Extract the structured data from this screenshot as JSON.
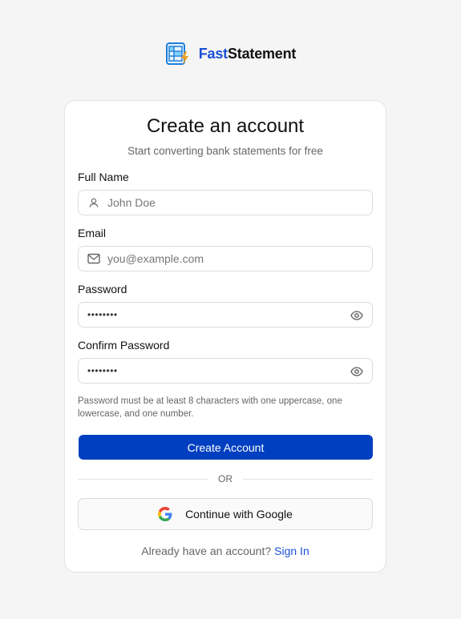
{
  "brand": {
    "name_part1": "Fast",
    "name_part2": "Statement",
    "logo_icon": "spreadsheet-lightning-icon",
    "accent": "#1a4fd6"
  },
  "card": {
    "title": "Create an account",
    "subtitle": "Start converting bank statements for free"
  },
  "form": {
    "full_name": {
      "label": "Full Name",
      "placeholder": "John Doe",
      "icon": "user-icon"
    },
    "email": {
      "label": "Email",
      "placeholder": "you@example.com",
      "icon": "mail-icon"
    },
    "password": {
      "label": "Password",
      "value": "••••••••",
      "icon": "eye-icon"
    },
    "confirm_password": {
      "label": "Confirm Password",
      "value": "••••••••",
      "icon": "eye-icon"
    },
    "hint": "Password must be at least 8 characters with one uppercase, one lowercase, and one number.",
    "submit_label": "Create Account",
    "submit_color": "#0040c0"
  },
  "divider": {
    "label": "OR"
  },
  "google": {
    "label": "Continue with Google",
    "icon": "google-icon"
  },
  "footer": {
    "text": "Already have an account?",
    "link_label": "Sign In"
  }
}
